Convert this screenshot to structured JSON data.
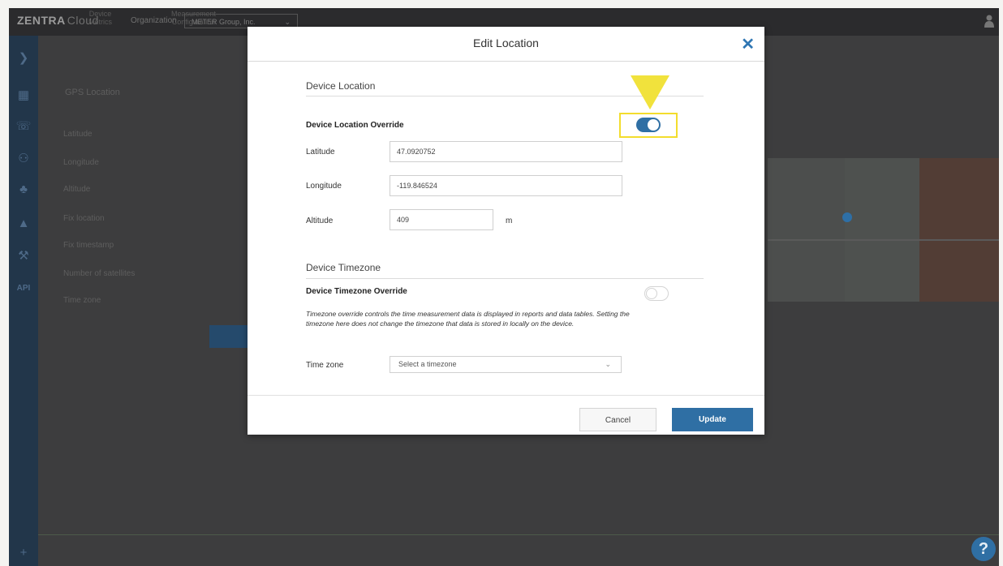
{
  "app": {
    "brand": "ZENTRA",
    "brand_suffix": "Cloud",
    "org_label": "Organization",
    "org_value": "METER Group, Inc.",
    "nav_left": "Device\nMetrics",
    "nav_right": "Measurement\nConfiguration",
    "gps_heading": "GPS Location",
    "bg_rows": [
      "Latitude",
      "Longitude",
      "Altitude",
      "Fix location",
      "Fix timestamp",
      "Number of satellites",
      "Time zone"
    ],
    "sidebar_api": "API"
  },
  "modal": {
    "title": "Edit Location",
    "close_icon": "close-icon",
    "location_section": "Device Location",
    "location_override_label": "Device Location Override",
    "location_override_on": true,
    "latitude_label": "Latitude",
    "latitude_value": "47.0920752",
    "longitude_label": "Longitude",
    "longitude_value": "-119.846524",
    "altitude_label": "Altitude",
    "altitude_value": "409",
    "altitude_unit": "m",
    "timezone_section": "Device Timezone",
    "timezone_override_label": "Device Timezone Override",
    "timezone_override_on": false,
    "timezone_note": "Timezone override controls the time measurement data is displayed in reports and data tables. Setting the timezone here does not change the timezone that data is stored in locally on the device.",
    "timezone_label": "Time zone",
    "timezone_placeholder": "Select a timezone",
    "cancel_label": "Cancel",
    "update_label": "Update"
  },
  "help": {
    "label": "?"
  },
  "colors": {
    "accent": "#2f6fa4",
    "highlight": "#f3dd2d",
    "sidebar": "#22364a"
  }
}
